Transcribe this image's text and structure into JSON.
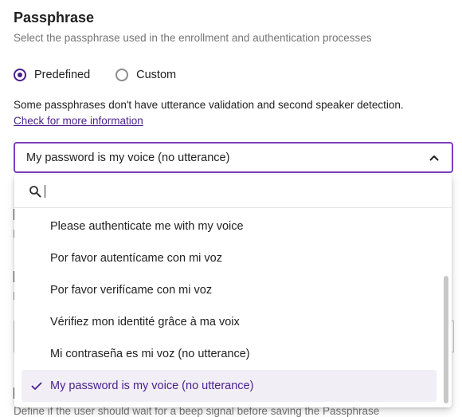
{
  "section": {
    "title": "Passphrase",
    "subtitle": "Select the passphrase used in the enrollment and authentication processes"
  },
  "mode": {
    "options": [
      {
        "label": "Predefined",
        "checked": true
      },
      {
        "label": "Custom",
        "checked": false
      }
    ]
  },
  "info": {
    "text": "Some passphrases don't have utterance validation and second speaker detection.",
    "link": "Check for more information"
  },
  "select": {
    "value": "My password is my voice (no utterance)"
  },
  "dropdown": {
    "search_value": "",
    "options": [
      {
        "label": "Please authenticate me with my voice",
        "selected": false
      },
      {
        "label": "Por favor autentícame con mi voz",
        "selected": false
      },
      {
        "label": "Por favor verifícame con mi voz",
        "selected": false
      },
      {
        "label": "Vérifiez mon identité grâce à ma voix",
        "selected": false
      },
      {
        "label": "Mi contraseña es mi voz (no utterance)",
        "selected": false
      },
      {
        "label": "My password is my voice (no utterance)",
        "selected": true
      }
    ]
  },
  "background": {
    "beep_description": "Define if the user should wait for a beep signal before saving the Passphrase"
  },
  "colors": {
    "accent": "#4a1f8c",
    "select_border": "#7b3fbf",
    "selected_bg": "#f1eef6"
  },
  "icons": {
    "search": "search-icon",
    "chevron": "chevron-up-icon",
    "check": "check-icon"
  }
}
